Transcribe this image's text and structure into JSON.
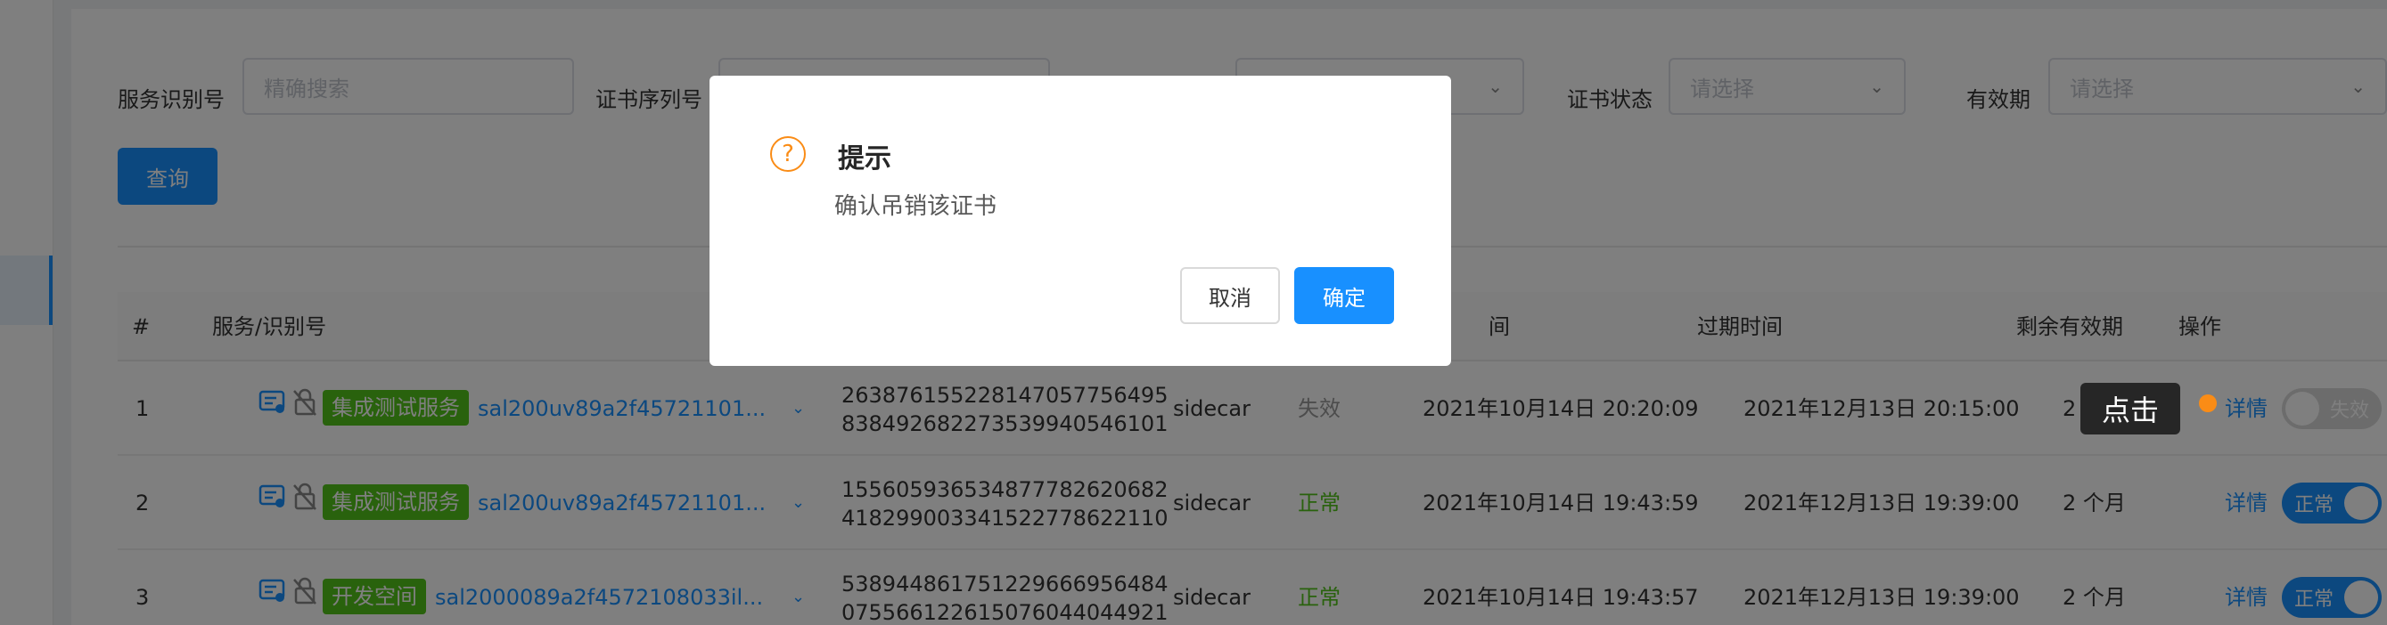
{
  "filters": {
    "service_id_label": "服务识别号",
    "service_id_placeholder": "精确搜索",
    "cert_serial_label": "证书序列号",
    "cert_status_label": "证书状态",
    "cert_status_placeholder": "请选择",
    "validity_label": "有效期",
    "validity_placeholder": "请选择",
    "query_label": "查询"
  },
  "table": {
    "headers": {
      "index": "#",
      "service": "服务/识别号",
      "issue_time": "间",
      "expire_time": "过期时间",
      "remaining": "剩余有效期",
      "action": "操作"
    },
    "rows": [
      {
        "index": "1",
        "tag": "集成测试服务",
        "service_id": "sal200uv89a2f45721101...",
        "serial_line1": "26387615522814705775649​5",
        "serial_line2": "838492682273539940546101",
        "type": "sidecar",
        "status": "失效",
        "issue_time": "2021年10月14日 20:20:09",
        "expire_time": "2021年12月13日 20:15:00",
        "remaining": "2 个月",
        "detail": "详情",
        "toggle": "失效",
        "toggle_on": false
      },
      {
        "index": "2",
        "tag": "集成测试服务",
        "service_id": "sal200uv89a2f45721101...",
        "serial_line1": "155605936534877782620682",
        "serial_line2": "418299003341522778622110",
        "type": "sidecar",
        "status": "正常",
        "issue_time": "2021年10月14日 19:43:59",
        "expire_time": "2021年12月13日 19:39:00",
        "remaining": "2 个月",
        "detail": "详情",
        "toggle": "正常",
        "toggle_on": true
      },
      {
        "index": "3",
        "tag": "开发空间",
        "service_id": "sal2000089a2f4572108033il...",
        "serial_line1": "538944861751229666956484",
        "serial_line2": "075566122615076044044921",
        "type": "sidecar",
        "status": "正常",
        "issue_time": "2021年10月14日 19:43:57",
        "expire_time": "2021年12月13日 19:39:00",
        "remaining": "2 个月",
        "detail": "详情",
        "toggle": "正常",
        "toggle_on": true
      }
    ]
  },
  "dialog": {
    "title": "提示",
    "message": "确认吊销该证书",
    "cancel_label": "取消",
    "ok_label": "确定"
  },
  "hint": {
    "click_label": "点击"
  },
  "colors": {
    "primary": "#1890ff",
    "success": "#52c41a",
    "warning": "#fa8c16",
    "mask": "rgba(0,0,0,0.5)"
  }
}
